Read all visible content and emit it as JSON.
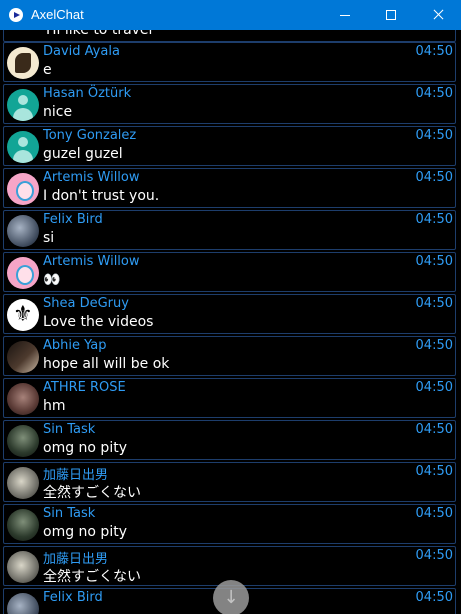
{
  "window": {
    "title": "AxelChat"
  },
  "partial_message": {
    "text": "Hi like to travel"
  },
  "messages": [
    {
      "author": "David Ayala",
      "time": "04:50",
      "text": "e",
      "avatar": "david"
    },
    {
      "author": "Hasan Öztürk",
      "time": "04:50",
      "text": "nice",
      "avatar": "default"
    },
    {
      "author": "Tony Gonzalez",
      "time": "04:50",
      "text": "guzel guzel",
      "avatar": "default"
    },
    {
      "author": "Artemis Willow",
      "time": "04:50",
      "text": "I don't trust you.",
      "avatar": "artemis"
    },
    {
      "author": "Felix Bird",
      "time": "04:50",
      "text": "si",
      "avatar": "felix"
    },
    {
      "author": "Artemis Willow",
      "time": "04:50",
      "text": "👀",
      "avatar": "artemis"
    },
    {
      "author": "Shea DeGruy",
      "time": "04:50",
      "text": "Love the videos",
      "avatar": "shea"
    },
    {
      "author": "Abhie Yap",
      "time": "04:50",
      "text": "hope all will be ok",
      "avatar": "abhie"
    },
    {
      "author": "ATHRE ROSE",
      "time": "04:50",
      "text": "hm",
      "avatar": "athre"
    },
    {
      "author": "Sin Task",
      "time": "04:50",
      "text": "omg no pity",
      "avatar": "sin"
    },
    {
      "author": "加藤日出男",
      "time": "04:50",
      "text": "全然すごくない",
      "avatar": "kato"
    },
    {
      "author": "Sin Task",
      "time": "04:50",
      "text": "omg no pity",
      "avatar": "sin"
    },
    {
      "author": "加藤日出男",
      "time": "04:50",
      "text": "全然すごくない",
      "avatar": "kato"
    },
    {
      "author": "Felix Bird",
      "time": "04:50",
      "text": "",
      "avatar": "felix"
    }
  ],
  "scroll_button": {
    "icon": "arrow-down-icon",
    "glyph": "↓"
  }
}
